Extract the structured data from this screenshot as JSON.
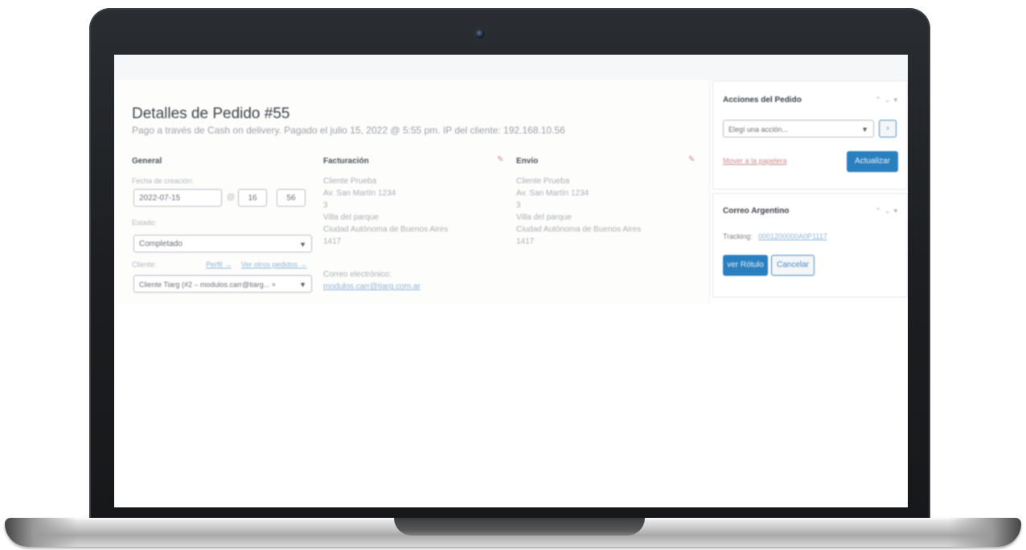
{
  "order": {
    "title": "Detalles de Pedido #55",
    "subtitle": "Pago a través de Cash on delivery. Pagado el julio 15, 2022 @ 5:55 pm. IP del cliente: 192.168.10.56"
  },
  "general": {
    "heading": "General",
    "created_label": "Fecha de creación:",
    "date_value": "2022-07-15",
    "at_symbol": "@",
    "hour_value": "16",
    "minute_value": "56",
    "status_label": "Estado:",
    "status_value": "Completado",
    "customer_label": "Cliente:",
    "profile_link": "Perfil →",
    "other_orders_link": "Ver otros pedidos →",
    "customer_value": "Cliente Tiarg (#2 – modulos.carr@tiarg... ×"
  },
  "billing": {
    "heading": "Facturación",
    "lines": [
      "Cliente Prueba",
      "Av. San Martín 1234",
      "3",
      "Villa del parque",
      "Ciudad Autónoma de Buenos Aires",
      "1417"
    ],
    "email_label": "Correo electrónico:",
    "email_value": "modulos.carr@tiarg.com.ar"
  },
  "shipping": {
    "heading": "Envío",
    "lines": [
      "Cliente Prueba",
      "Av. San Martín 1234",
      "3",
      "Villa del parque",
      "Ciudad Autónoma de Buenos Aires",
      "1417"
    ]
  },
  "order_actions": {
    "title": "Acciones del Pedido",
    "select_placeholder": "Elegí una acción...",
    "go_button": "›",
    "trash_link": "Mover a la papelera",
    "update_button": "Actualizar"
  },
  "correo": {
    "title": "Correo Argentino",
    "tracking_label": "Tracking:",
    "tracking_value": "0001200000A0P1117",
    "view_label_button": "ver Rótulo",
    "cancel_button": "Cancelar"
  },
  "colors": {
    "accent": "#2a7fbf",
    "link": "#8fb3d4",
    "bezel": "#1c1e21"
  }
}
